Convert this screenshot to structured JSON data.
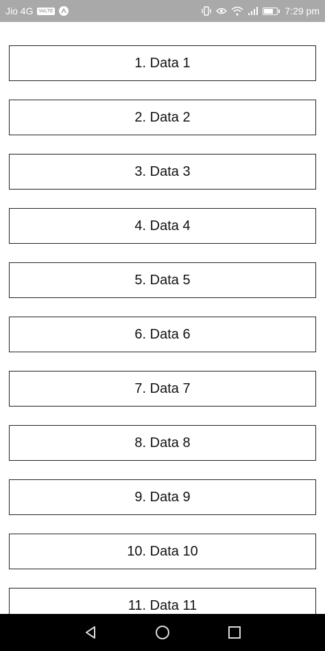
{
  "status_bar": {
    "carrier": "Jio 4G",
    "volte": "VoLTE",
    "time": "7:29 pm",
    "battery_level": 0.75,
    "icons": [
      "volte-icon",
      "notification-a-icon",
      "vibrate-icon",
      "eye-icon",
      "wifi-icon",
      "signal-icon",
      "battery-icon"
    ]
  },
  "list": {
    "items": [
      {
        "label": "1. Data 1"
      },
      {
        "label": "2. Data 2"
      },
      {
        "label": "3. Data 3"
      },
      {
        "label": "4. Data 4"
      },
      {
        "label": "5. Data 5"
      },
      {
        "label": "6. Data 6"
      },
      {
        "label": "7. Data 7"
      },
      {
        "label": "8. Data 8"
      },
      {
        "label": "9. Data 9"
      },
      {
        "label": "10. Data 10"
      },
      {
        "label": "11. Data 11"
      }
    ]
  },
  "nav_bar": {
    "icons": [
      "back-icon",
      "home-icon",
      "recents-icon"
    ]
  },
  "colors": {
    "status_bar_bg": "#a9a9a9",
    "nav_bar_bg": "#000000",
    "item_border": "#222222"
  }
}
